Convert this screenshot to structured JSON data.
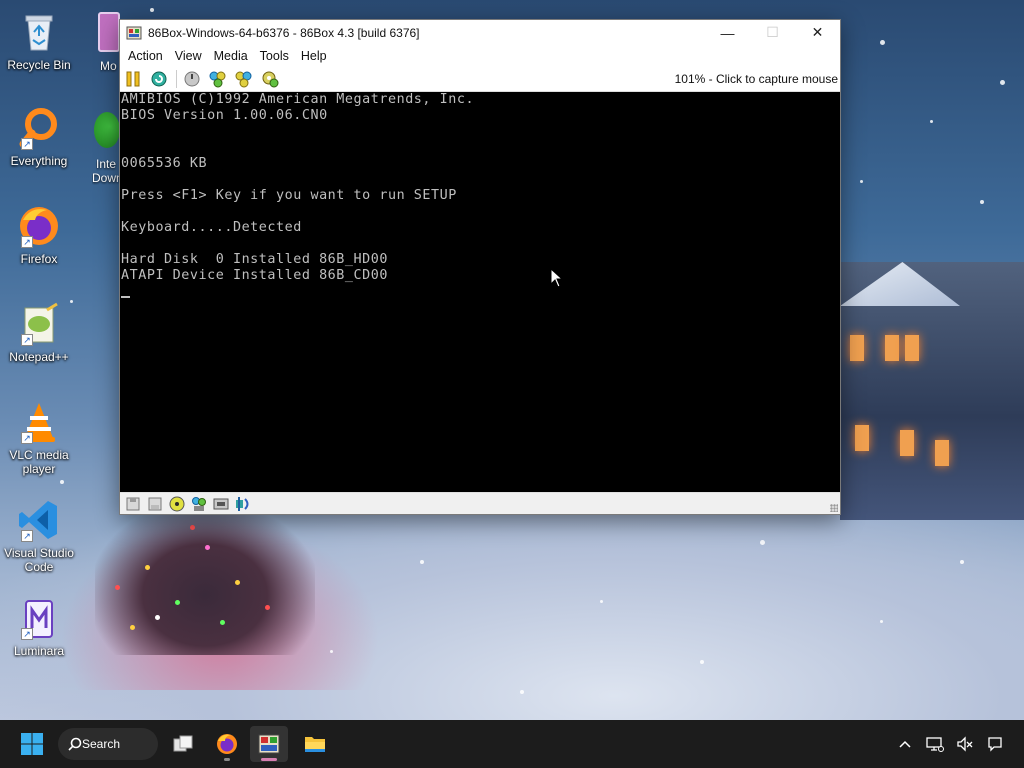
{
  "desktop": {
    "icons": [
      {
        "label": "Recycle Bin",
        "icon": "recycle-bin-icon"
      },
      {
        "label": "Everything",
        "icon": "everything-search-icon"
      },
      {
        "label": "Firefox",
        "icon": "firefox-icon"
      },
      {
        "label": "Notepad++",
        "icon": "notepad-plus-plus-icon"
      },
      {
        "label": "VLC media player",
        "icon": "vlc-icon"
      },
      {
        "label": "Visual Studio Code",
        "icon": "vscode-icon"
      },
      {
        "label": "Luminara",
        "icon": "luminara-icon"
      }
    ],
    "partial_labels": [
      "Mo",
      "Inte",
      "Down"
    ]
  },
  "window": {
    "title": "86Box-Windows-64-b6376 - 86Box 4.3 [build 6376]",
    "controls": {
      "minimize": "—",
      "maximize": "☐",
      "close": "✕"
    },
    "menu": [
      "Action",
      "View",
      "Media",
      "Tools",
      "Help"
    ],
    "toolbar_icons": [
      "pause-icon",
      "reset-icon",
      "power-icon",
      "ctrl-alt-del-icon",
      "ctrl-alt-esc-icon",
      "settings-icon"
    ],
    "capture_text": "101% - Click to capture mouse",
    "screen_lines": [
      "AMIBIOS (C)1992 American Megatrends, Inc.",
      "BIOS Version 1.00.06.CN0",
      "",
      "",
      "0065536 KB",
      "",
      "Press <F1> Key if you want to run SETUP",
      "",
      "Keyboard.....Detected",
      "",
      "Hard Disk  0 Installed 86B_HD00",
      "ATAPI Device Installed 86B_CD00"
    ],
    "status_icons": [
      "floppy-a-icon",
      "floppy-b-icon",
      "cdrom-icon",
      "hard-disk-icon",
      "network-icon",
      "sound-icon"
    ]
  },
  "taskbar": {
    "search_label": "Search",
    "apps": [
      "task-view-icon",
      "firefox-icon",
      "86box-icon",
      "file-explorer-icon"
    ],
    "tray": [
      "chevron-up-icon",
      "network-icon",
      "volume-muted-icon",
      "notification-icon"
    ]
  },
  "colors": {
    "screen_bg": "#000000",
    "screen_text": "#bfbfbf",
    "taskbar_bg": "#1c1c1c"
  }
}
